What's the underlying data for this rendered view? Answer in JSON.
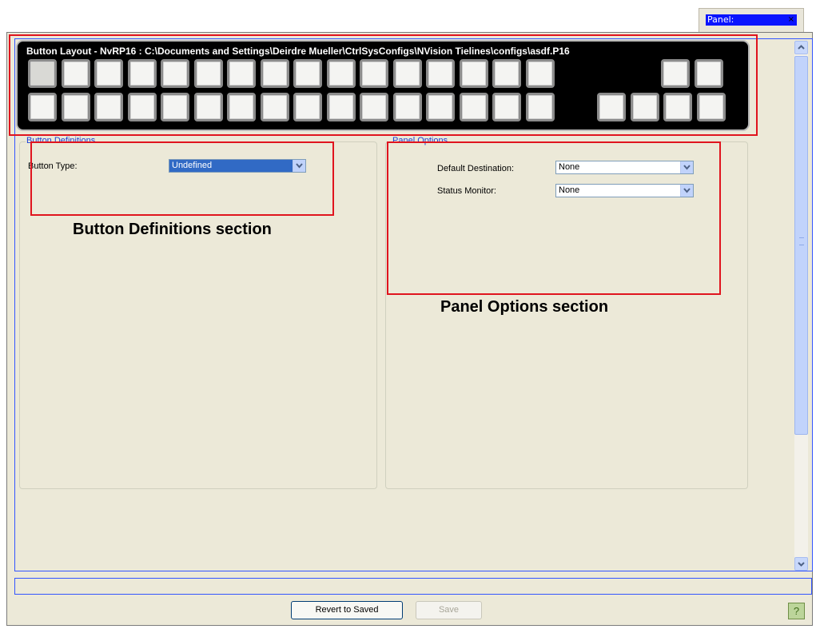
{
  "tab": {
    "label": "Panel:",
    "close": "×"
  },
  "button_layout": {
    "title": "Button Layout - NvRP16 : C:\\Documents and Settings\\Deirdre Mueller\\CtrlSysConfigs\\NVision Tielines\\configs\\asdf.P16",
    "rows": [
      {
        "main_count": 16,
        "extra_count": 2,
        "selected_index": 0
      },
      {
        "main_count": 16,
        "extra_count": 4
      }
    ]
  },
  "button_definitions": {
    "title": "Button Definitions",
    "button_type_label": "Button Type:",
    "button_type_value": "Undefined"
  },
  "panel_options": {
    "title": "Panel Options",
    "default_destination_label": "Default Destination:",
    "default_destination_value": "None",
    "status_monitor_label": "Status Monitor:",
    "status_monitor_value": "None"
  },
  "annotations": {
    "button_definitions_caption": "Button Definitions section",
    "panel_options_caption": "Panel Options section"
  },
  "footer": {
    "revert_label": "Revert to Saved",
    "save_label": "Save",
    "help_label": "?"
  },
  "colors": {
    "highlight": "#0a14ff",
    "annotation_red": "#e0141e",
    "group_title_blue": "#1c3fd6",
    "window_bg": "#ece9d8"
  }
}
